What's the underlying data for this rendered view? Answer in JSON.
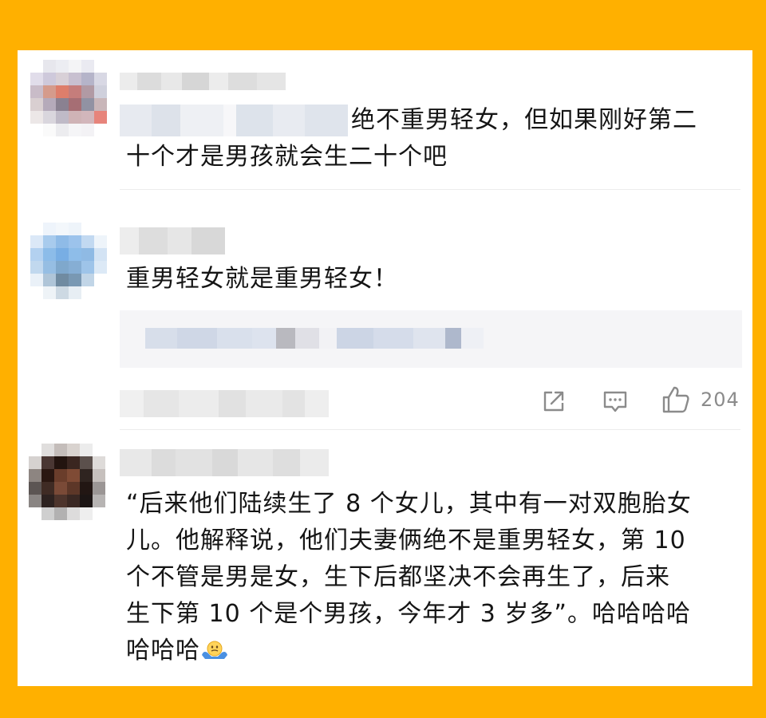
{
  "comments": [
    {
      "text": "绝不重男轻女，但如果刚好第二\n十个才是男孩就会生二十个吧",
      "avatar_icon": "pixelated-avatar"
    },
    {
      "text": "重男轻女就是重男轻女！",
      "avatar_icon": "pixelated-avatar"
    },
    {
      "text": "“后来他们陆续生了 8 个女儿，其中有一对双胞胎女\n儿。他解释说，他们夫妻俩绝不是重男轻女，第 10\n个不管是男是女，生下后都坚决不会再生了，后来\n生下第 10 个是个男孩，今年才 3 岁多”。哈哈哈哈\n哈哈哈",
      "avatar_icon": "pixelated-avatar",
      "emoji_icon": "shrug-emoji-icon"
    }
  ],
  "actions": {
    "share_icon": "share-icon",
    "reply_icon": "comment-icon",
    "like_icon": "thumbs-up-icon",
    "like_count": "204"
  },
  "colors": {
    "frame": "#FFB000",
    "card": "#FFFFFF",
    "text": "#151515",
    "icon": "#8B8B8B"
  }
}
